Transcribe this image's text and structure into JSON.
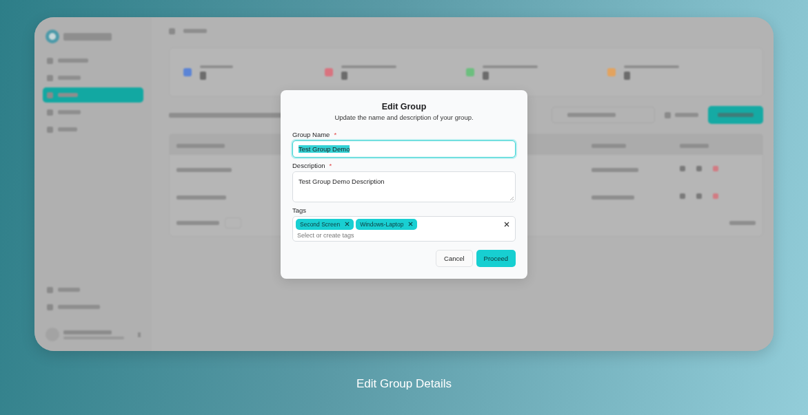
{
  "dialog": {
    "title": "Edit Group",
    "subtitle": "Update the name and description of your group.",
    "name_field": {
      "label": "Group Name",
      "required_mark": "*",
      "value": "Test Group Demo",
      "focused": true,
      "text_selected": true
    },
    "description_field": {
      "label": "Description",
      "required_mark": "*",
      "value": "Test Group Demo Description"
    },
    "tags_field": {
      "label": "Tags",
      "tags": [
        "Second Screen",
        "Windows-Laptop"
      ],
      "placeholder": "Select or create tags"
    },
    "buttons": [
      {
        "label": "Cancel",
        "kind": "secondary"
      },
      {
        "label": "Proceed",
        "kind": "primary"
      }
    ]
  },
  "caption": "Edit Group Details"
}
